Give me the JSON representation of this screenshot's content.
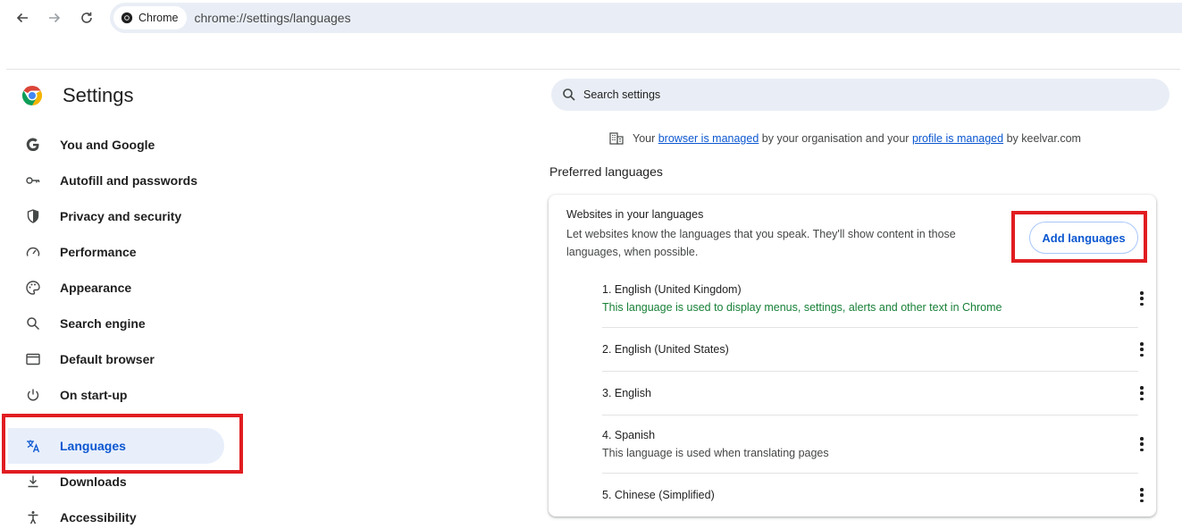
{
  "toolbar": {
    "chip_label": "Chrome",
    "url": "chrome://settings/languages"
  },
  "sidebar": {
    "title": "Settings",
    "items": [
      {
        "label": "You and Google",
        "icon": "google-g-icon"
      },
      {
        "label": "Autofill and passwords",
        "icon": "key-icon"
      },
      {
        "label": "Privacy and security",
        "icon": "shield-icon"
      },
      {
        "label": "Performance",
        "icon": "speedometer-icon"
      },
      {
        "label": "Appearance",
        "icon": "palette-icon"
      },
      {
        "label": "Search engine",
        "icon": "search-icon"
      },
      {
        "label": "Default browser",
        "icon": "browser-window-icon"
      },
      {
        "label": "On start-up",
        "icon": "power-icon"
      },
      {
        "label": "Languages",
        "icon": "translate-icon",
        "active": true
      },
      {
        "label": "Downloads",
        "icon": "download-icon"
      },
      {
        "label": "Accessibility",
        "icon": "accessibility-icon"
      }
    ]
  },
  "search": {
    "placeholder": "Search settings"
  },
  "managed": {
    "prefix": "Your ",
    "browser_link": "browser is managed",
    "middle": " by your organisation and your ",
    "profile_link": "profile is managed",
    "suffix": " by keelvar.com"
  },
  "main": {
    "section_title": "Preferred languages",
    "card": {
      "title": "Websites in your languages",
      "description": "Let websites know the languages that you speak. They'll show content in those languages, when possible.",
      "add_button": "Add languages",
      "languages": [
        {
          "name": "1. English (United Kingdom)",
          "note": "This language is used to display menus, settings, alerts and other text in Chrome"
        },
        {
          "name": "2. English (United States)",
          "note": ""
        },
        {
          "name": "3. English",
          "note": ""
        },
        {
          "name": "4. Spanish",
          "note": "This language is used when translating pages"
        },
        {
          "name": "5. Chinese (Simplified)",
          "note": ""
        }
      ]
    }
  },
  "colors": {
    "accent": "#0b57d0",
    "highlight_box": "#e11d21",
    "ui_language_note": "#188038"
  }
}
